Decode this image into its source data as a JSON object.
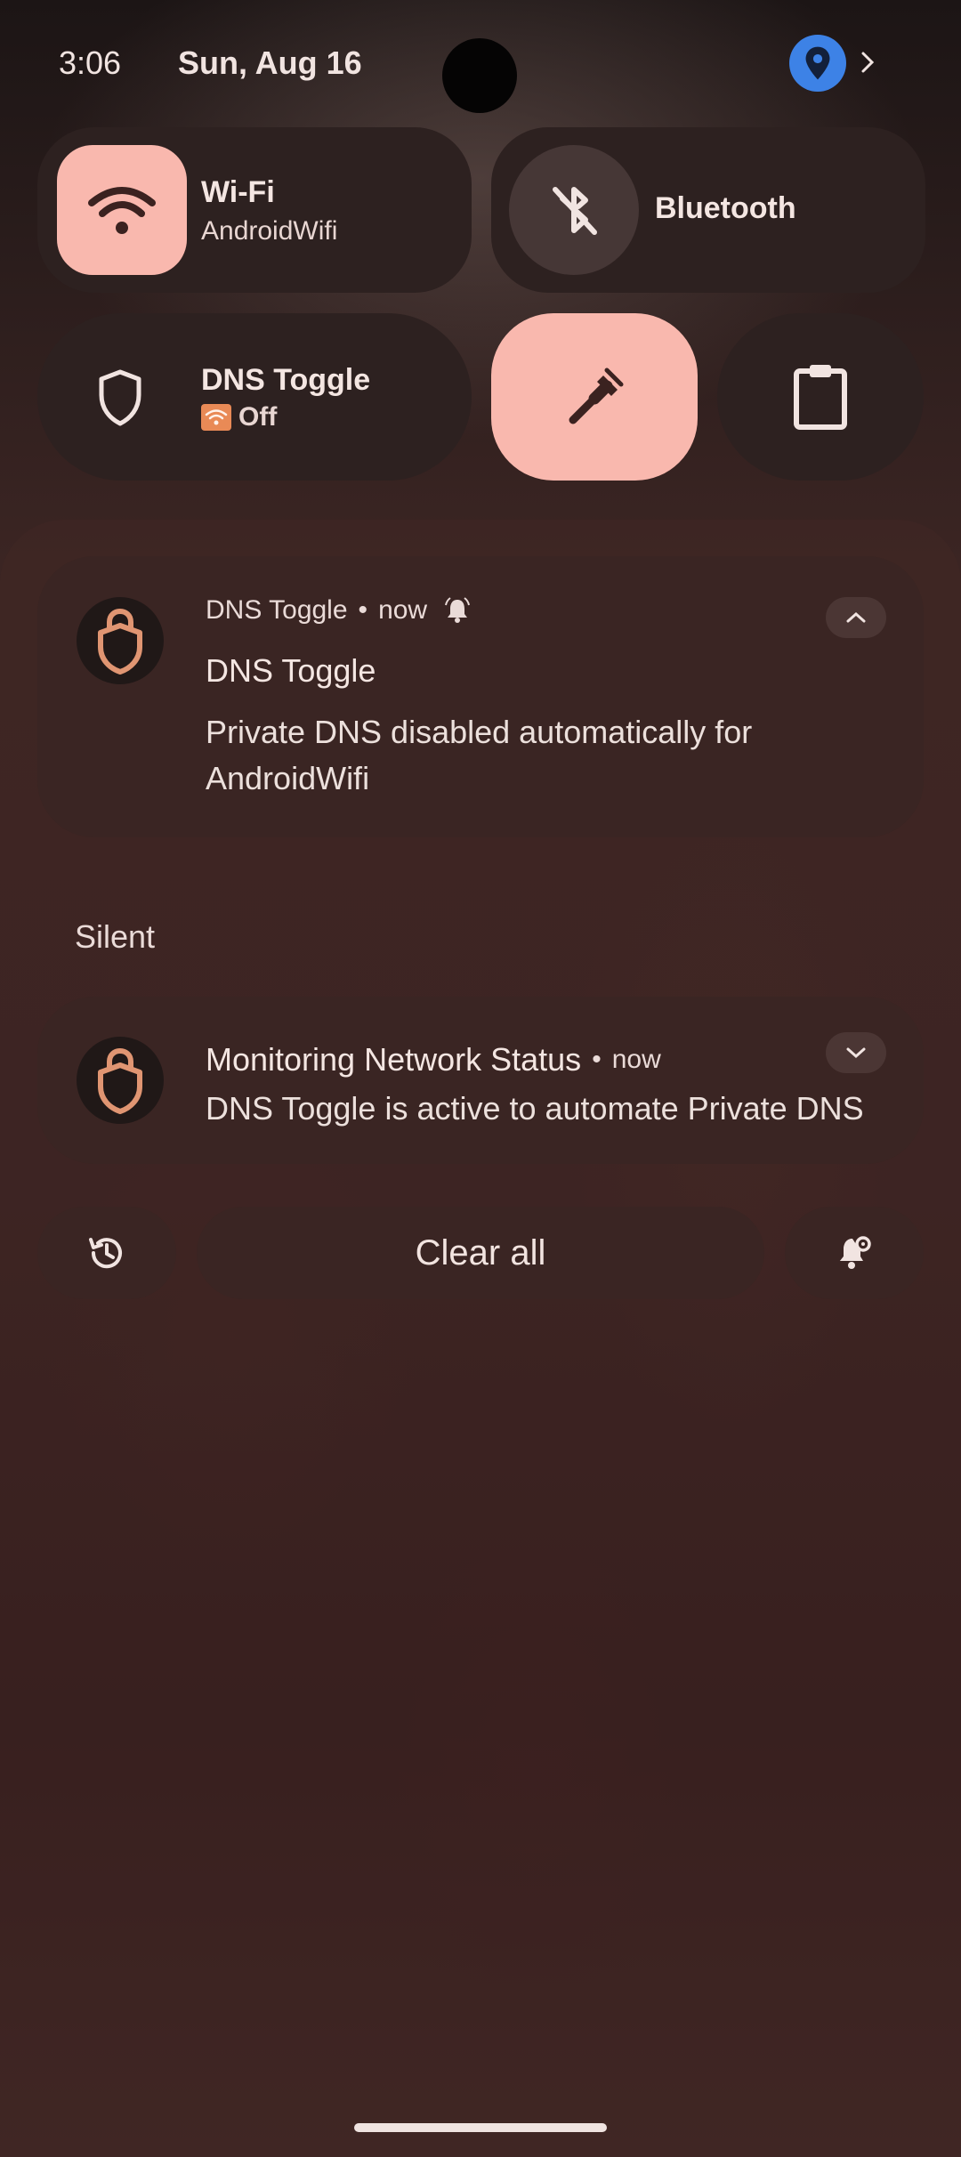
{
  "status_bar": {
    "time": "3:06",
    "date": "Sun, Aug 16"
  },
  "quick_settings": {
    "wifi": {
      "title": "Wi-Fi",
      "subtitle": "AndroidWifi",
      "active": true,
      "icon": "wifi-icon"
    },
    "bluetooth": {
      "title": "Bluetooth",
      "active": false,
      "icon": "bluetooth-off-icon"
    },
    "dns_toggle": {
      "title": "DNS Toggle",
      "subtitle": "Off",
      "icon": "shield-icon"
    },
    "tool": {
      "active": true,
      "icon": "wrench-icon"
    },
    "clipboard": {
      "icon": "clipboard-icon"
    }
  },
  "notifications": {
    "alerting": {
      "app_name": "DNS Toggle",
      "time": "now",
      "title": "DNS Toggle",
      "body": "Private DNS disabled automatically for AndroidWifi"
    },
    "silent_label": "Silent",
    "silent": {
      "title": "Monitoring Network Status",
      "time": "now",
      "body": "DNS Toggle is active to automate Private DNS"
    }
  },
  "actions": {
    "clear_all": "Clear all"
  },
  "colors": {
    "accent": "#f9b8ae",
    "tile_bg": "#2d2120",
    "card_bg": "#3a2523",
    "location_blue": "#3d82e6",
    "shield_orange": "#e09572"
  }
}
